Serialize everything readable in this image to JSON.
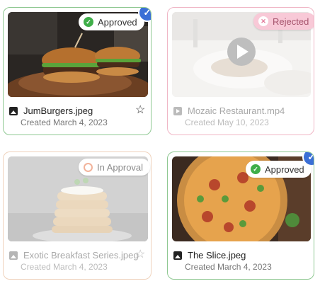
{
  "cards": [
    {
      "file_name": "JumBurgers.jpeg",
      "created": "Created March 4, 2023",
      "status": "Approved",
      "file_type": "image-icon",
      "selected": true,
      "favorite_icon": "star-outline-icon"
    },
    {
      "file_name": "Mozaic Restaurant.mp4",
      "created": "Created May 10, 2023",
      "status": "Rejected",
      "file_type": "video-icon",
      "selected": false
    },
    {
      "file_name": "Exotic Breakfast Series.jpeg",
      "created": "Created March 4, 2023",
      "status": "In Approval",
      "file_type": "image-icon",
      "selected": false,
      "favorite_icon": "star-outline-icon"
    },
    {
      "file_name": "The Slice.jpeg",
      "created": "Created March 4, 2023",
      "status": "Approved",
      "file_type": "image-icon",
      "selected": true
    }
  ],
  "colors": {
    "approved": "#3fae49",
    "rejected": "#e27b9b",
    "in_approval": "#f2b39b",
    "selected": "#3b6fd6"
  }
}
